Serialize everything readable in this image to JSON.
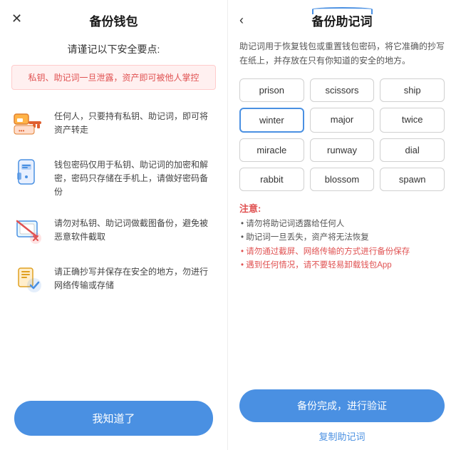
{
  "left": {
    "title": "备份钱包",
    "close_icon": "✕",
    "subtitle": "请谨记以下安全要点:",
    "warning": "私钥、助记词一旦泄露，资产即可被他人掌控",
    "items": [
      {
        "id": "key",
        "text": "任何人，只要持有私钥、助记词，即可将资产转走"
      },
      {
        "id": "password",
        "text": "钱包密码仅用于私钥、助记词的加密和解密，密码只存储在手机上，请做好密码备份"
      },
      {
        "id": "screenshot",
        "text": "请勿对私钥、助记词做截图备份，避免被恶意软件截取"
      },
      {
        "id": "safe",
        "text": "请正确抄写并保存在安全的地方，勿进行网络传输或存储"
      }
    ],
    "button": "我知道了"
  },
  "right": {
    "back_icon": "‹",
    "title": "备份助记词",
    "desc": "助记词用于恢复钱包或重置钱包密码，将它准确的抄写在纸上，并存放在只有你知道的安全的地方。",
    "words": [
      "prison",
      "scissors",
      "ship",
      "winter",
      "major",
      "twice",
      "miracle",
      "runway",
      "dial",
      "rabbit",
      "blossom",
      "spawn"
    ],
    "highlighted_word": "winter",
    "notes_title": "注意:",
    "notes": [
      {
        "text": "• 请勿将助记词透露给任何人",
        "red": false
      },
      {
        "text": "• 助记词一旦丢失，资产将无法恢复",
        "red": false
      },
      {
        "text": "• 请勿通过截屏、网络传输的方式进行备份保存",
        "red": true
      },
      {
        "text": "• 遇到任何情况，请不要轻易卸载钱包App",
        "red": true
      }
    ],
    "main_button": "备份完成，进行验证",
    "copy_link": "复制助记词"
  }
}
